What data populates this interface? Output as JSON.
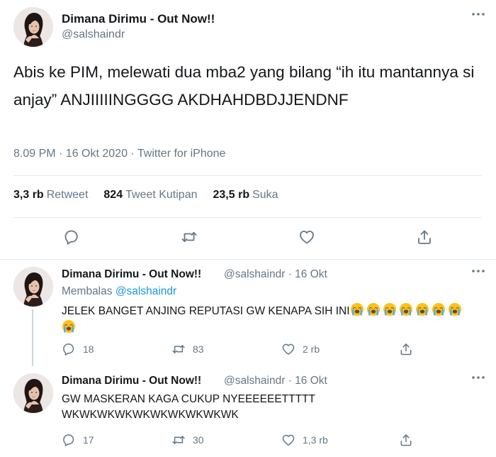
{
  "main_tweet": {
    "display_name": "Dimana Dirimu - Out Now!!",
    "handle": "@salshaindr",
    "text": "Abis ke PIM, melewati dua mba2 yang bilang “ih itu mantannya si anjay” ANJIIIIINGGGG AKDHAHDBDJJENDNF",
    "meta": "8.09 PM · 16 Okt 2020 · Twitter for iPhone",
    "stats": [
      {
        "value": "3,3 rb",
        "label": "Retweet"
      },
      {
        "value": "824",
        "label": "Tweet Kutipan"
      },
      {
        "value": "23,5 rb",
        "label": "Suka"
      }
    ],
    "icons": [
      "reply-icon",
      "retweet-icon",
      "like-icon",
      "share-icon"
    ]
  },
  "replies": [
    {
      "display_name": "Dimana Dirimu - Out Now!!",
      "handle_time": "@salshaindr · 16 Okt",
      "replying_prefix": "Membalas",
      "replying_to": "@salshaindr",
      "text": "JELEK BANGET ANJING REPUTASI GW KENAPA SIH INI",
      "emoji_count": 8,
      "emoji_name": "loudly-crying-face",
      "actions": {
        "replies": "18",
        "retweets": "83",
        "likes": "2 rb"
      }
    },
    {
      "display_name": "Dimana Dirimu - Out Now!!",
      "handle_time": "@salshaindr · 16 Okt",
      "text_line1": "GW MASKERAN KAGA CUKUP NYEEEEEETTTTT",
      "text_line2": "WKWKWKWKWKWKWKWKWKWK",
      "actions": {
        "replies": "17",
        "retweets": "30",
        "likes": "1,3 rb"
      }
    }
  ],
  "colors": {
    "text": "#14171a",
    "secondary": "#657786",
    "link": "#1b95e0",
    "border": "#e6ecf0",
    "thread_line": "#ccd6dd"
  }
}
